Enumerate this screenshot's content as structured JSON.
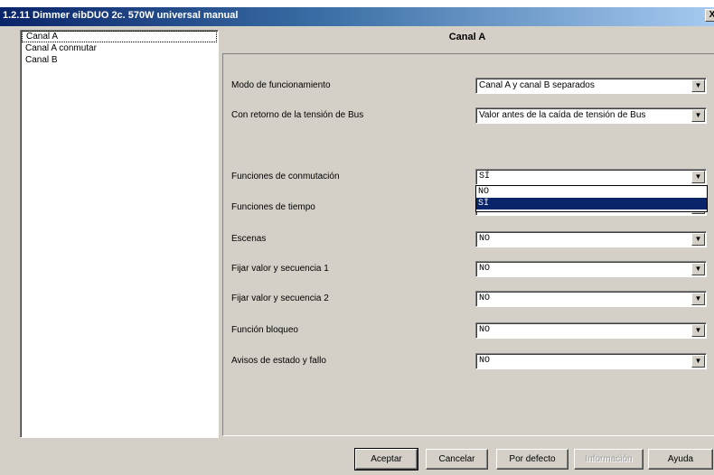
{
  "window": {
    "title": "1.2.11 Dimmer eibDUO 2c. 570W universal manual",
    "close_glyph": "X"
  },
  "tree": {
    "items": [
      {
        "label": "Canal A",
        "selected": true
      },
      {
        "label": "Canal A conmutar",
        "selected": false
      },
      {
        "label": "Canal B",
        "selected": false
      }
    ]
  },
  "panel": {
    "title": "Canal A",
    "rows": [
      {
        "label": "Modo de funcionamiento",
        "value": "Canal A y canal B separados"
      },
      {
        "label": "Con retorno de la tensión de Bus",
        "value": "Valor antes de la caída de tensión de Bus"
      },
      {
        "label": "Funciones de conmutación",
        "value": "SÍ"
      },
      {
        "label": "Funciones de tiempo",
        "value": ""
      },
      {
        "label": "Escenas",
        "value": "NO"
      },
      {
        "label": "Fijar valor y secuencia 1",
        "value": "NO"
      },
      {
        "label": "Fijar valor y secuencia 2",
        "value": "NO"
      },
      {
        "label": "Función bloqueo",
        "value": "NO"
      },
      {
        "label": "Avisos de estado y fallo",
        "value": "NO"
      }
    ],
    "dropdown_open": {
      "options": [
        "NO",
        "SÍ"
      ],
      "highlighted": "SÍ"
    }
  },
  "buttons": {
    "ok": "Aceptar",
    "cancel": "Cancelar",
    "defaults": "Por defecto",
    "info": "Información",
    "help": "Ayuda"
  },
  "icons": {
    "arrow": "▼"
  },
  "colors": {
    "title_bar": "#0a246a",
    "face": "#d4d0c8",
    "highlight": "#0a246a"
  }
}
